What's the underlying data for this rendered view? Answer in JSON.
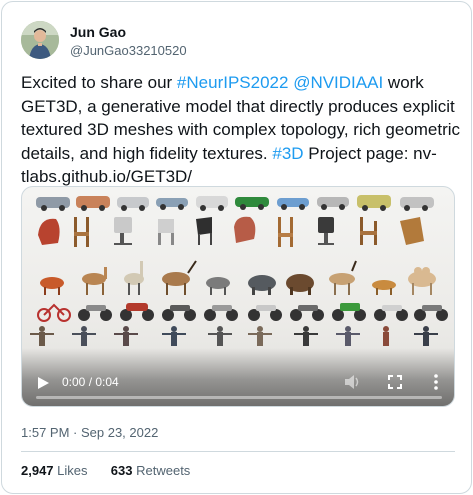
{
  "author": {
    "name": "Jun Gao",
    "handle": "@JunGao33210520"
  },
  "tweet": {
    "text_1": "Excited to share our ",
    "hashtag_neurips": "#NeurIPS2022",
    "text_2": " ",
    "mention_nvidia": "@NVIDIAAI",
    "text_3": " work GET3D, a generative model that directly produces explicit textured 3D meshes with complex topology, rich geometric details, and high fidelity textures. ",
    "hashtag_3d": "#3D",
    "text_4": " Project page: nv-tlabs.github.io/GET3D/"
  },
  "video": {
    "time": "0:00 / 0:04",
    "progress": 0,
    "rows": [
      "cars",
      "chairs",
      "animals",
      "motorbikes",
      "people"
    ]
  },
  "meta": {
    "timestamp": "1:57 PM · Sep 23, 2022",
    "likes_count": "2,947",
    "likes_label": "Likes",
    "retweets_count": "633",
    "retweets_label": "Retweets"
  },
  "colors": {
    "text": "#0f1419",
    "secondary": "#536471",
    "link": "#1d9bf0",
    "border": "#cfd9de"
  }
}
